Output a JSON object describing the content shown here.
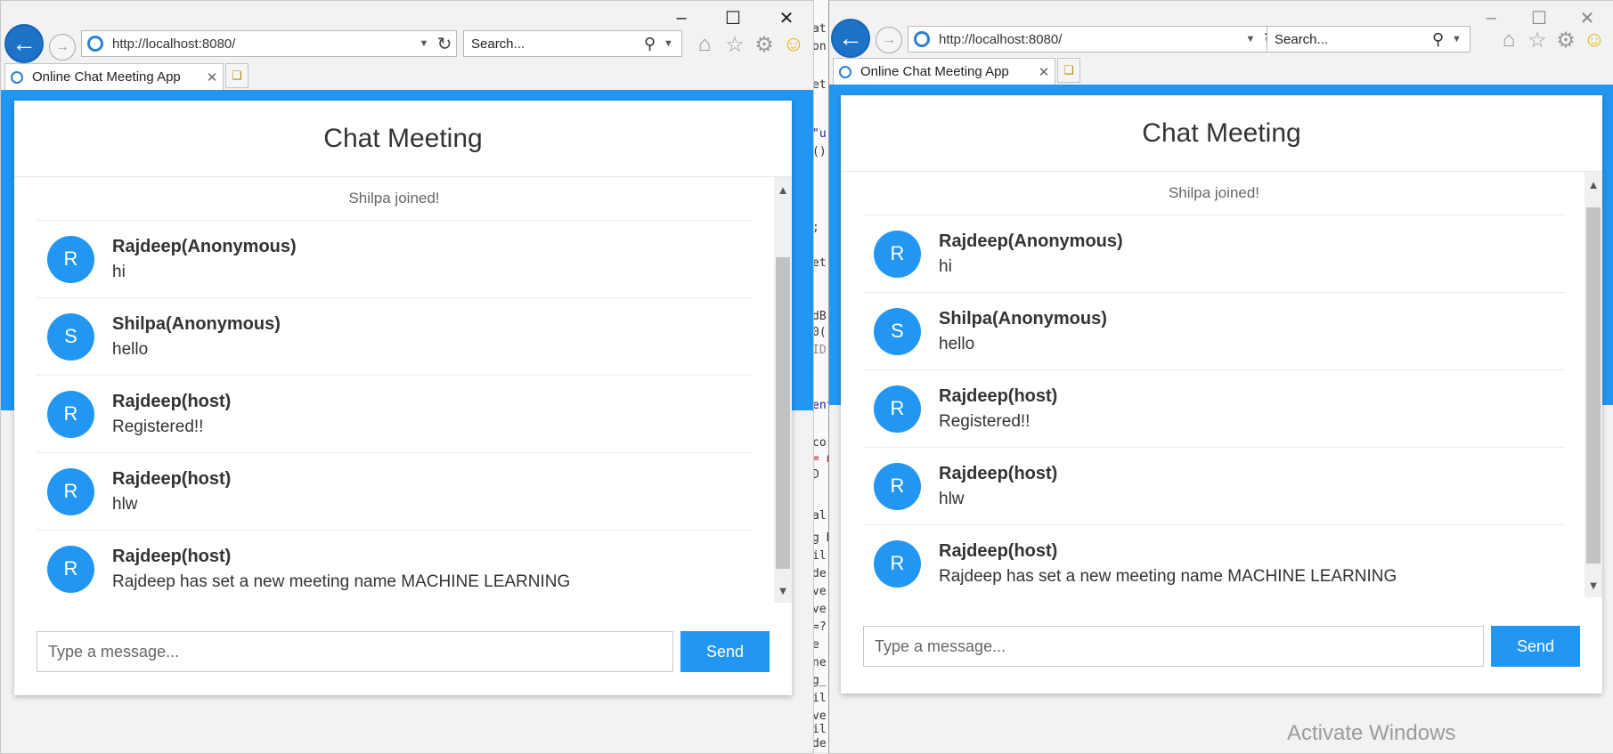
{
  "browser": {
    "url": "http://localhost:8080/",
    "search_placeholder": "Search...",
    "tab_title": "Online Chat Meeting App"
  },
  "chat": {
    "title": "Chat Meeting",
    "system_message": "Shilpa joined!",
    "messages": [
      {
        "initial": "R",
        "sender": "Rajdeep(Anonymous)",
        "text": "hi"
      },
      {
        "initial": "S",
        "sender": "Shilpa(Anonymous)",
        "text": "hello"
      },
      {
        "initial": "R",
        "sender": "Rajdeep(host)",
        "text": "Registered!!"
      },
      {
        "initial": "R",
        "sender": "Rajdeep(host)",
        "text": "hlw"
      },
      {
        "initial": "R",
        "sender": "Rajdeep(host)",
        "text": "Rajdeep has set a new meeting name MACHINE LEARNING"
      }
    ],
    "input_placeholder": "Type a message...",
    "send_label": "Send"
  },
  "background_code": [
    "at",
    "on",
    "et",
    "\"u",
    "()",
    ";",
    "et",
    "dB",
    "0(",
    "ID",
    "ent",
    "co",
    "= n",
    "D",
    "al",
    "g B",
    "il",
    "de",
    "ve",
    "ve",
    "=?",
    "e",
    "ne",
    "g_",
    "il",
    "ve",
    "il",
    "de"
  ],
  "os_watermark": "Activate Windows",
  "colors": {
    "accent": "#2196f3",
    "ie_back": "#1e73c8"
  },
  "icons": [
    "back-arrow-icon",
    "forward-arrow-icon",
    "ie-logo-icon",
    "refresh-icon",
    "search-icon",
    "home-icon",
    "favorites-star-icon",
    "settings-gear-icon",
    "smiley-feedback-icon",
    "close-tab-icon",
    "new-tab-icon",
    "minimize-icon",
    "maximize-icon",
    "close-icon"
  ]
}
